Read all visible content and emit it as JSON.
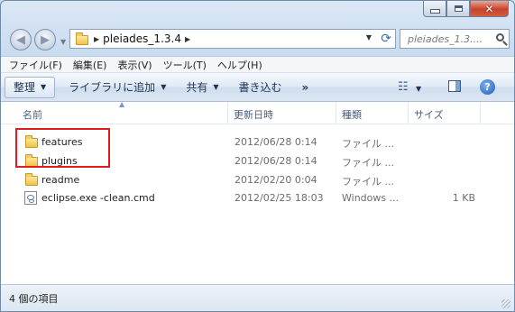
{
  "window": {
    "address_path": "pleiades_1.3.4",
    "search_placeholder": "pleiades_1.3...."
  },
  "menu": [
    "ファイル(F)",
    "編集(E)",
    "表示(V)",
    "ツール(T)",
    "ヘルプ(H)"
  ],
  "toolbar": {
    "organize": "整理",
    "add_to_library": "ライブラリに追加",
    "share": "共有",
    "burn": "書き込む",
    "more": "»"
  },
  "columns": {
    "name": "名前",
    "modified": "更新日時",
    "type": "種類",
    "size": "サイズ"
  },
  "files": [
    {
      "name": "features",
      "modified": "2012/06/28 0:14",
      "type": "ファイル ...",
      "size": "",
      "icon": "folder-icon"
    },
    {
      "name": "plugins",
      "modified": "2012/06/28 0:14",
      "type": "ファイル ...",
      "size": "",
      "icon": "folder-icon"
    },
    {
      "name": "readme",
      "modified": "2012/02/20 0:04",
      "type": "ファイル ...",
      "size": "",
      "icon": "folder-icon"
    },
    {
      "name": "eclipse.exe -clean.cmd",
      "modified": "2012/02/25 18:03",
      "type": "Windows ...",
      "size": "1 KB",
      "icon": "cmd-file-icon"
    }
  ],
  "status": {
    "item_count": "4 個の項目"
  },
  "colors": {
    "highlight_box": "#e21c1c",
    "window_chrome": "#c9dbef"
  }
}
